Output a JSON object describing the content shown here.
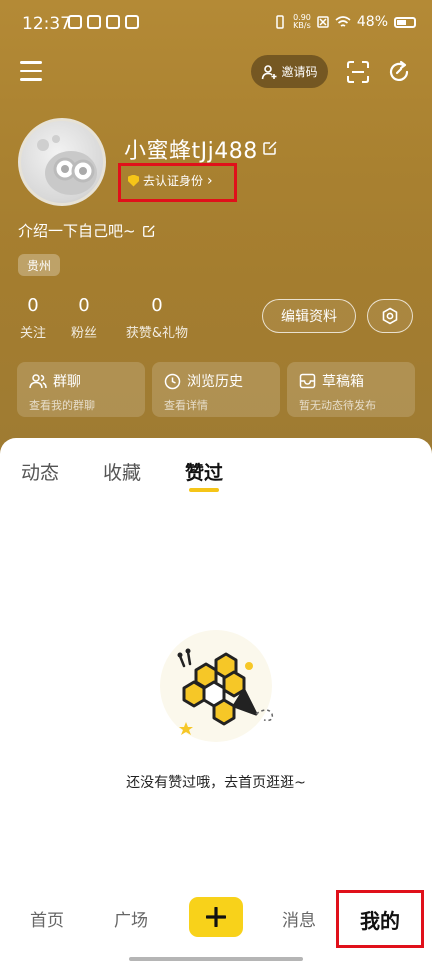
{
  "status_bar": {
    "time": "12:37",
    "net_speed_value": "0.90",
    "net_speed_unit": "KB/s",
    "battery": "48%"
  },
  "top_nav": {
    "invite_label": "邀请码"
  },
  "profile": {
    "username": "小蜜蜂tJj488",
    "verify_label": "去认证身份",
    "bio": "介绍一下自己吧~",
    "location": "贵州",
    "stats": [
      {
        "value": "0",
        "label": "关注"
      },
      {
        "value": "0",
        "label": "粉丝"
      },
      {
        "value": "0",
        "label": "获赞&礼物"
      }
    ],
    "edit_label": "编辑资料"
  },
  "cards": [
    {
      "title": "群聊",
      "subtitle": "查看我的群聊",
      "icon": "group-icon"
    },
    {
      "title": "浏览历史",
      "subtitle": "查看详情",
      "icon": "clock-icon"
    },
    {
      "title": "草稿箱",
      "subtitle": "暂无动态待发布",
      "icon": "inbox-icon"
    }
  ],
  "tabs": [
    {
      "label": "动态",
      "active": false
    },
    {
      "label": "收藏",
      "active": false
    },
    {
      "label": "赞过",
      "active": true
    }
  ],
  "empty_state": {
    "message": "还没有赞过哦，去首页逛逛~"
  },
  "bottom_nav": {
    "items": [
      {
        "label": "首页"
      },
      {
        "label": "广场"
      },
      {
        "label": "消息"
      },
      {
        "label": "我的"
      }
    ]
  },
  "colors": {
    "accent": "#f5c518",
    "highlight_box": "#e0101a",
    "header": "#a98130"
  }
}
